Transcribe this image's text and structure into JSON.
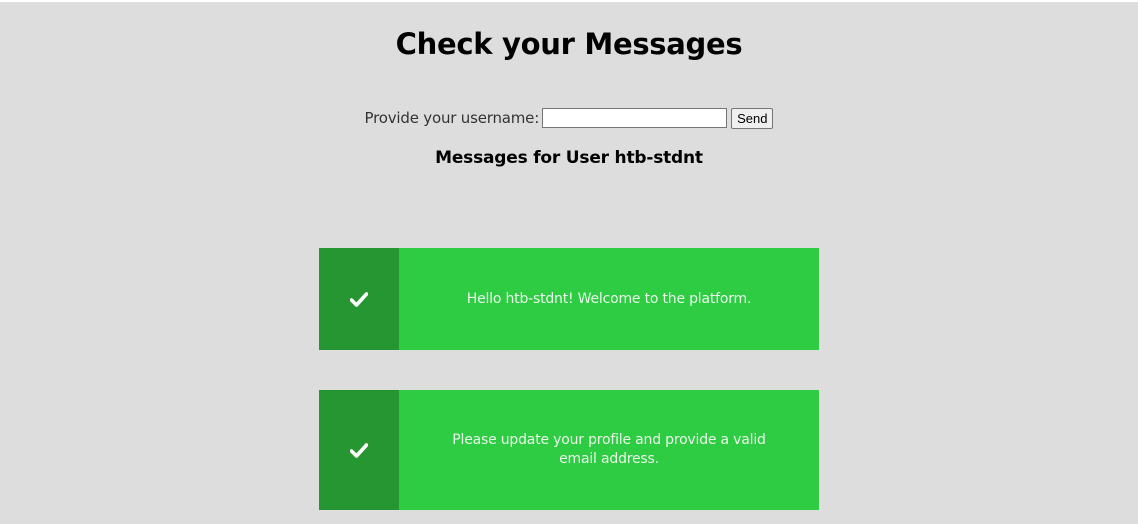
{
  "page": {
    "title": "Check your Messages"
  },
  "form": {
    "label": "Provide your username:",
    "input_value": "",
    "send_label": "Send"
  },
  "messages_heading": "Messages for User htb-stdnt",
  "messages": [
    {
      "icon": "check-icon",
      "text": "Hello htb-stdnt! Welcome to the platform."
    },
    {
      "icon": "check-icon",
      "text": "Please update your profile and provide a valid email address."
    }
  ],
  "colors": {
    "background": "#dddddd",
    "message_bg": "#2ecc42",
    "icon_bg": "#259631",
    "message_text": "#e9f7ea"
  }
}
